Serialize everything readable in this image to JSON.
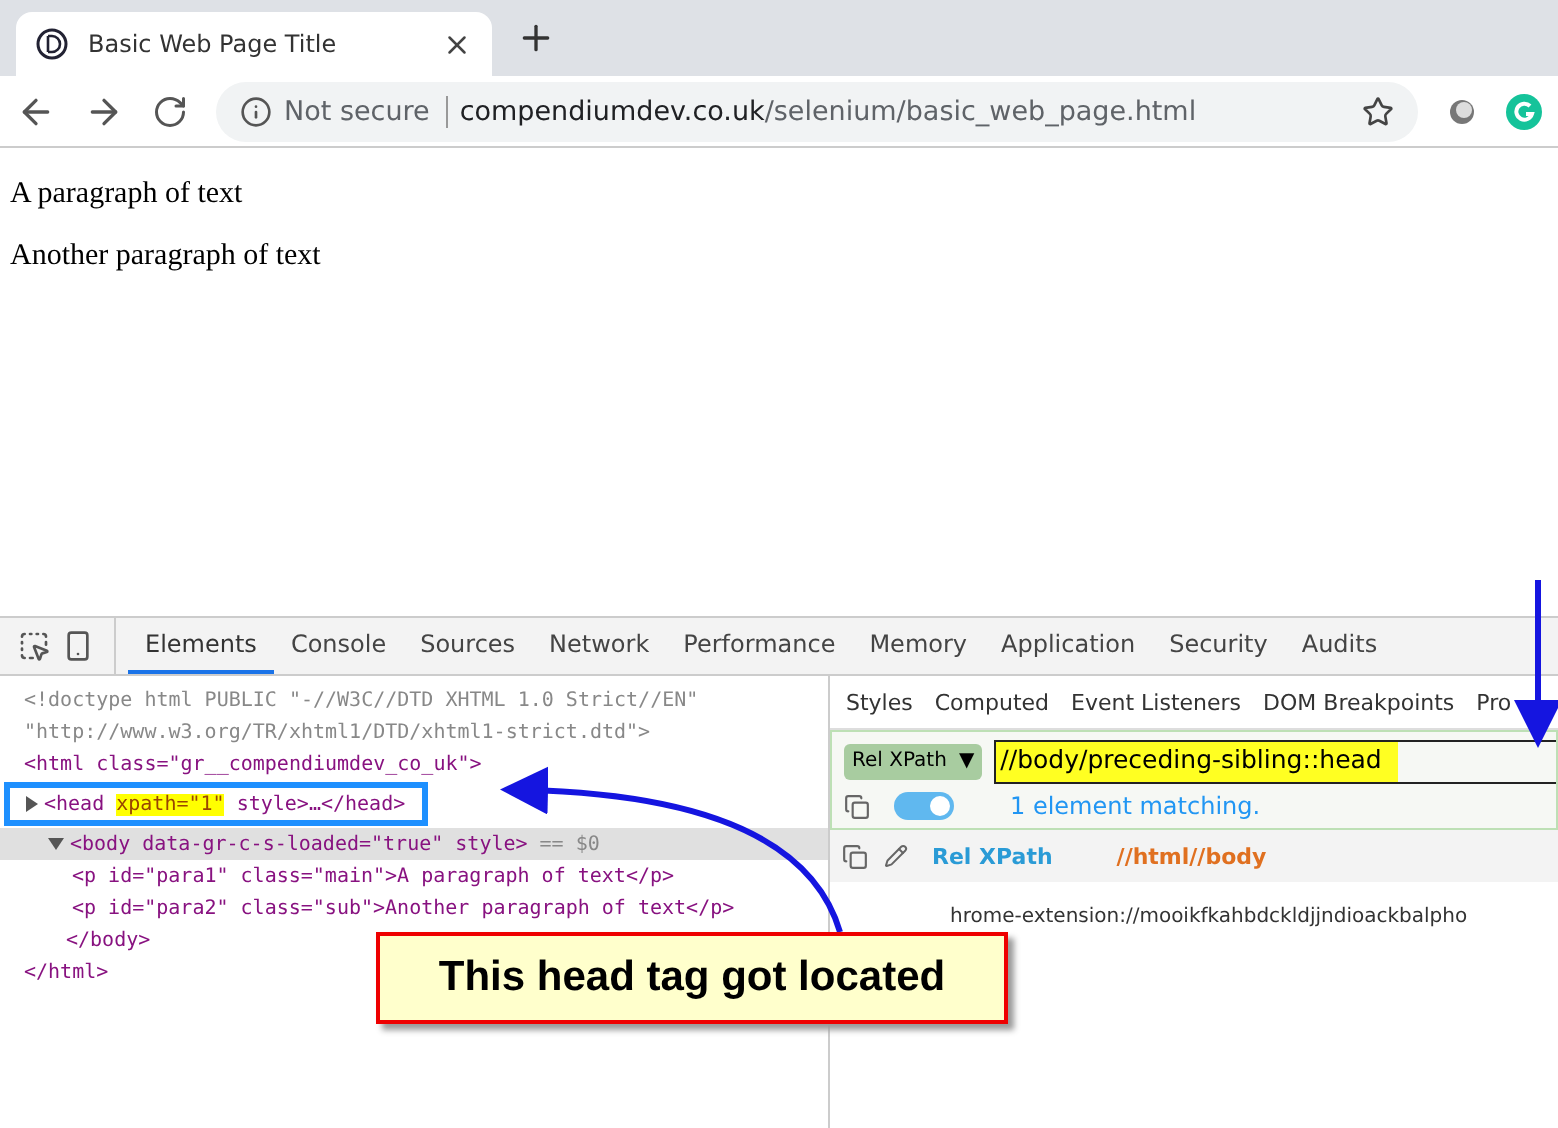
{
  "browser": {
    "tab": {
      "title": "Basic Web Page Title"
    },
    "address": {
      "security": "Not secure",
      "domain": "compendiumdev.co.uk",
      "path": "/selenium/basic_web_page.html"
    }
  },
  "page": {
    "paragraphs": [
      "A paragraph of text",
      "Another paragraph of text"
    ]
  },
  "devtools": {
    "tabs": [
      {
        "label": "Elements",
        "selected": true
      },
      {
        "label": "Console",
        "selected": false
      },
      {
        "label": "Sources",
        "selected": false
      },
      {
        "label": "Network",
        "selected": false
      },
      {
        "label": "Performance",
        "selected": false
      },
      {
        "label": "Memory",
        "selected": false
      },
      {
        "label": "Application",
        "selected": false
      },
      {
        "label": "Security",
        "selected": false
      },
      {
        "label": "Audits",
        "selected": false
      }
    ],
    "doctype": [
      "<!doctype html PUBLIC \"-//W3C//DTD XHTML 1.0 Strict//EN\"",
      "\"http://www.w3.org/TR/xhtml1/DTD/xhtml1-strict.dtd\">"
    ],
    "dom": [
      {
        "code": "<html class=\"gr__compendiumdev_co_uk\">",
        "closing": "</html>",
        "children": [
          {
            "code": "<head ",
            "mark": "xpath=\"1\"",
            "code_after": " style>…</head>",
            "framed": true,
            "expanded": false,
            "selected": false
          },
          {
            "code": "<body data-gr-c-s-loaded=\"true\" style>",
            "note": "== $0",
            "expanded": true,
            "selected": true,
            "closing": "</body>",
            "children": [
              {
                "code": "<p id=\"para1\" class=\"main\">A paragraph of text</p>"
              },
              {
                "code": "<p id=\"para2\" class=\"sub\">Another paragraph of text</p>"
              }
            ]
          }
        ]
      }
    ],
    "side_tabs": [
      "Styles",
      "Computed",
      "Event Listeners",
      "DOM Breakpoints",
      "Pro"
    ],
    "selector": {
      "mode": "Rel XPath",
      "caret": "▼",
      "value": "//body/preceding-sibling::head",
      "toggle_on": true,
      "result": "1 element matching."
    },
    "suggestion": {
      "label": "Rel XPath",
      "xpath": "//html//body"
    },
    "extension_line": "hrome-extension://mooikfkahbdckldjjndioackbalpho"
  },
  "callout": "This head tag got located"
}
